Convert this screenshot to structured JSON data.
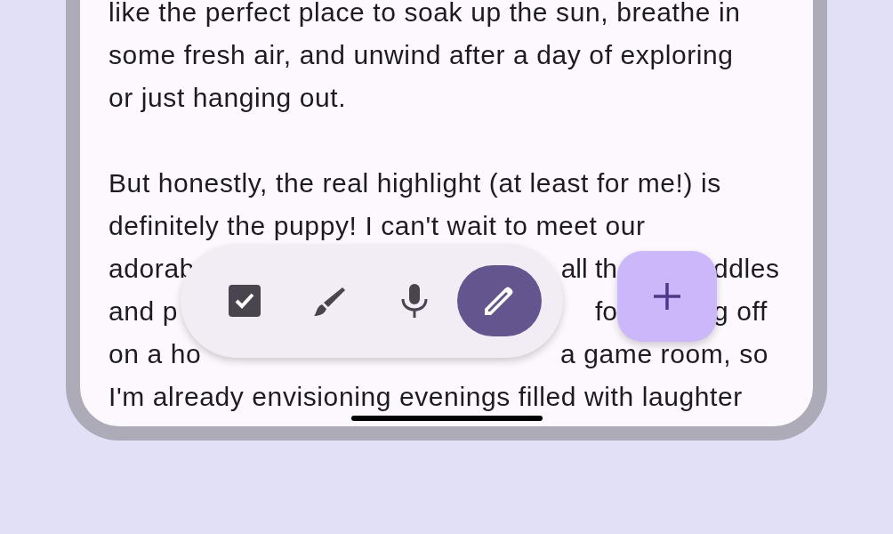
{
  "note": {
    "paragraphs": [
      {
        "lines": [
          {
            "segments": [
              "like the perfect place to soak up the sun, breathe in"
            ]
          },
          {
            "segments": [
              "some fresh air, and unwind after a day of exploring"
            ]
          },
          {
            "segments": [
              "or just hanging out."
            ]
          }
        ]
      },
      {
        "lines": [
          {
            "segments": [
              "But honestly, the real highlight (at least for me!) is"
            ]
          },
          {
            "segments": [
              "definitely the puppy! I can't wait to meet our"
            ]
          },
          {
            "segments": [
              "adorab",
              "all th",
              "ddles"
            ]
          },
          {
            "segments": [
              "and p",
              "fo",
              "g off"
            ]
          },
          {
            "segments": [
              "on a ho",
              "a game room, so"
            ]
          },
          {
            "segments": [
              "I'm already envisioning evenings filled with laughter"
            ]
          }
        ]
      }
    ]
  },
  "toolbar": {
    "items": [
      {
        "kind": "checklist",
        "selected": false
      },
      {
        "kind": "brush",
        "selected": false
      },
      {
        "kind": "microphone",
        "selected": false
      },
      {
        "kind": "pen",
        "selected": true
      }
    ]
  },
  "fab": {
    "kind": "add"
  }
}
